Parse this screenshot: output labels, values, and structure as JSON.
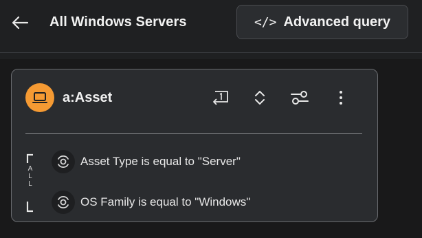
{
  "header": {
    "back_icon": "arrow-left-icon",
    "title": "All Windows Servers",
    "advanced_query_icon": "code-icon",
    "advanced_query_code_glyph": "</>",
    "advanced_query_label": "Advanced query"
  },
  "card": {
    "asset_icon": "laptop-icon",
    "asset_label": "a:Asset",
    "tools": [
      "return-one-icon",
      "expand-collapse-icon",
      "settings-sliders-icon",
      "more-vertical-icon"
    ],
    "group_operator_letters": [
      "A",
      "L",
      "L"
    ],
    "conditions": [
      {
        "icon": "target-icon",
        "text": "Asset Type is equal to \"Server\""
      },
      {
        "icon": "target-icon",
        "text": "OS Family is equal to \"Windows\""
      }
    ]
  },
  "colors": {
    "background": "#1f2022",
    "card": "#2a2c2f",
    "accent_orange": "#f59a33",
    "text": "#f2f2f2"
  }
}
